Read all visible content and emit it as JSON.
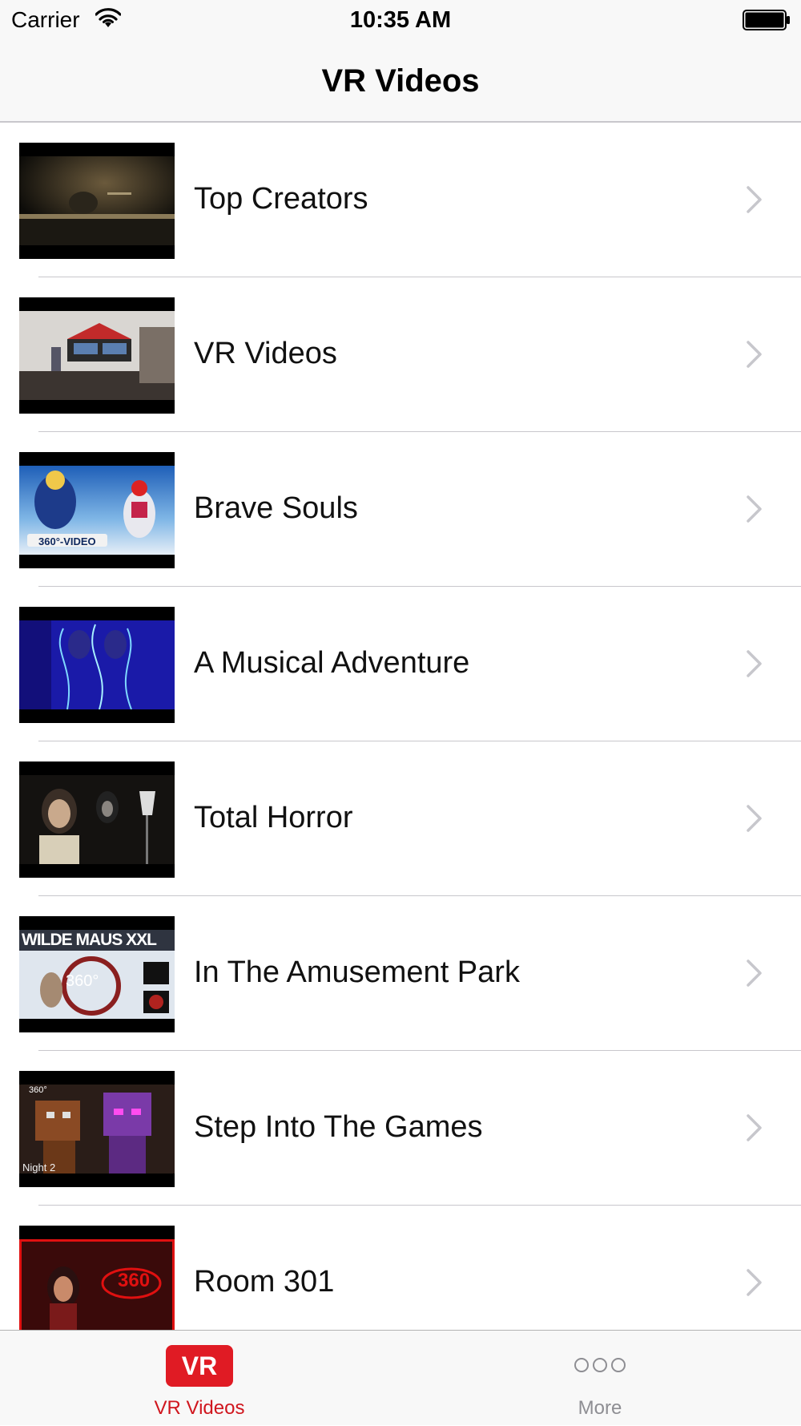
{
  "status_bar": {
    "carrier": "Carrier",
    "time": "10:35 AM"
  },
  "nav": {
    "title": "VR Videos"
  },
  "rows": [
    {
      "label": "Top Creators",
      "thumb_icon": "dark-stage-thumbnail"
    },
    {
      "label": "VR Videos",
      "thumb_icon": "studio-room-thumbnail"
    },
    {
      "label": "Brave Souls",
      "thumb_icon": "ski-360-thumbnail",
      "thumb_text": "360°-VIDEO"
    },
    {
      "label": "A Musical Adventure",
      "thumb_icon": "neon-dancers-thumbnail"
    },
    {
      "label": "Total Horror",
      "thumb_icon": "horror-nun-thumbnail"
    },
    {
      "label": "In The Amusement Park",
      "thumb_icon": "rollercoaster-thumbnail",
      "thumb_text": "WILDE MAUS XXL",
      "thumb_text2": "360°"
    },
    {
      "label": "Step Into The Games",
      "thumb_icon": "game-characters-thumbnail",
      "thumb_text": "360°",
      "thumb_text2": "Night 2"
    },
    {
      "label": "Room 301",
      "thumb_icon": "red-room-thumbnail",
      "thumb_text": "360"
    }
  ],
  "tab_bar": {
    "tabs": [
      {
        "label": "VR Videos",
        "badge": "VR",
        "selected": true
      },
      {
        "label": "More",
        "icon": "more-icon",
        "selected": false
      }
    ]
  },
  "colors": {
    "accent": "#d0161e",
    "badge_bg": "#e01b24",
    "inactive_tab": "#8e8e93",
    "separator": "#c8c7cc",
    "chevron": "#c7c7cc"
  }
}
